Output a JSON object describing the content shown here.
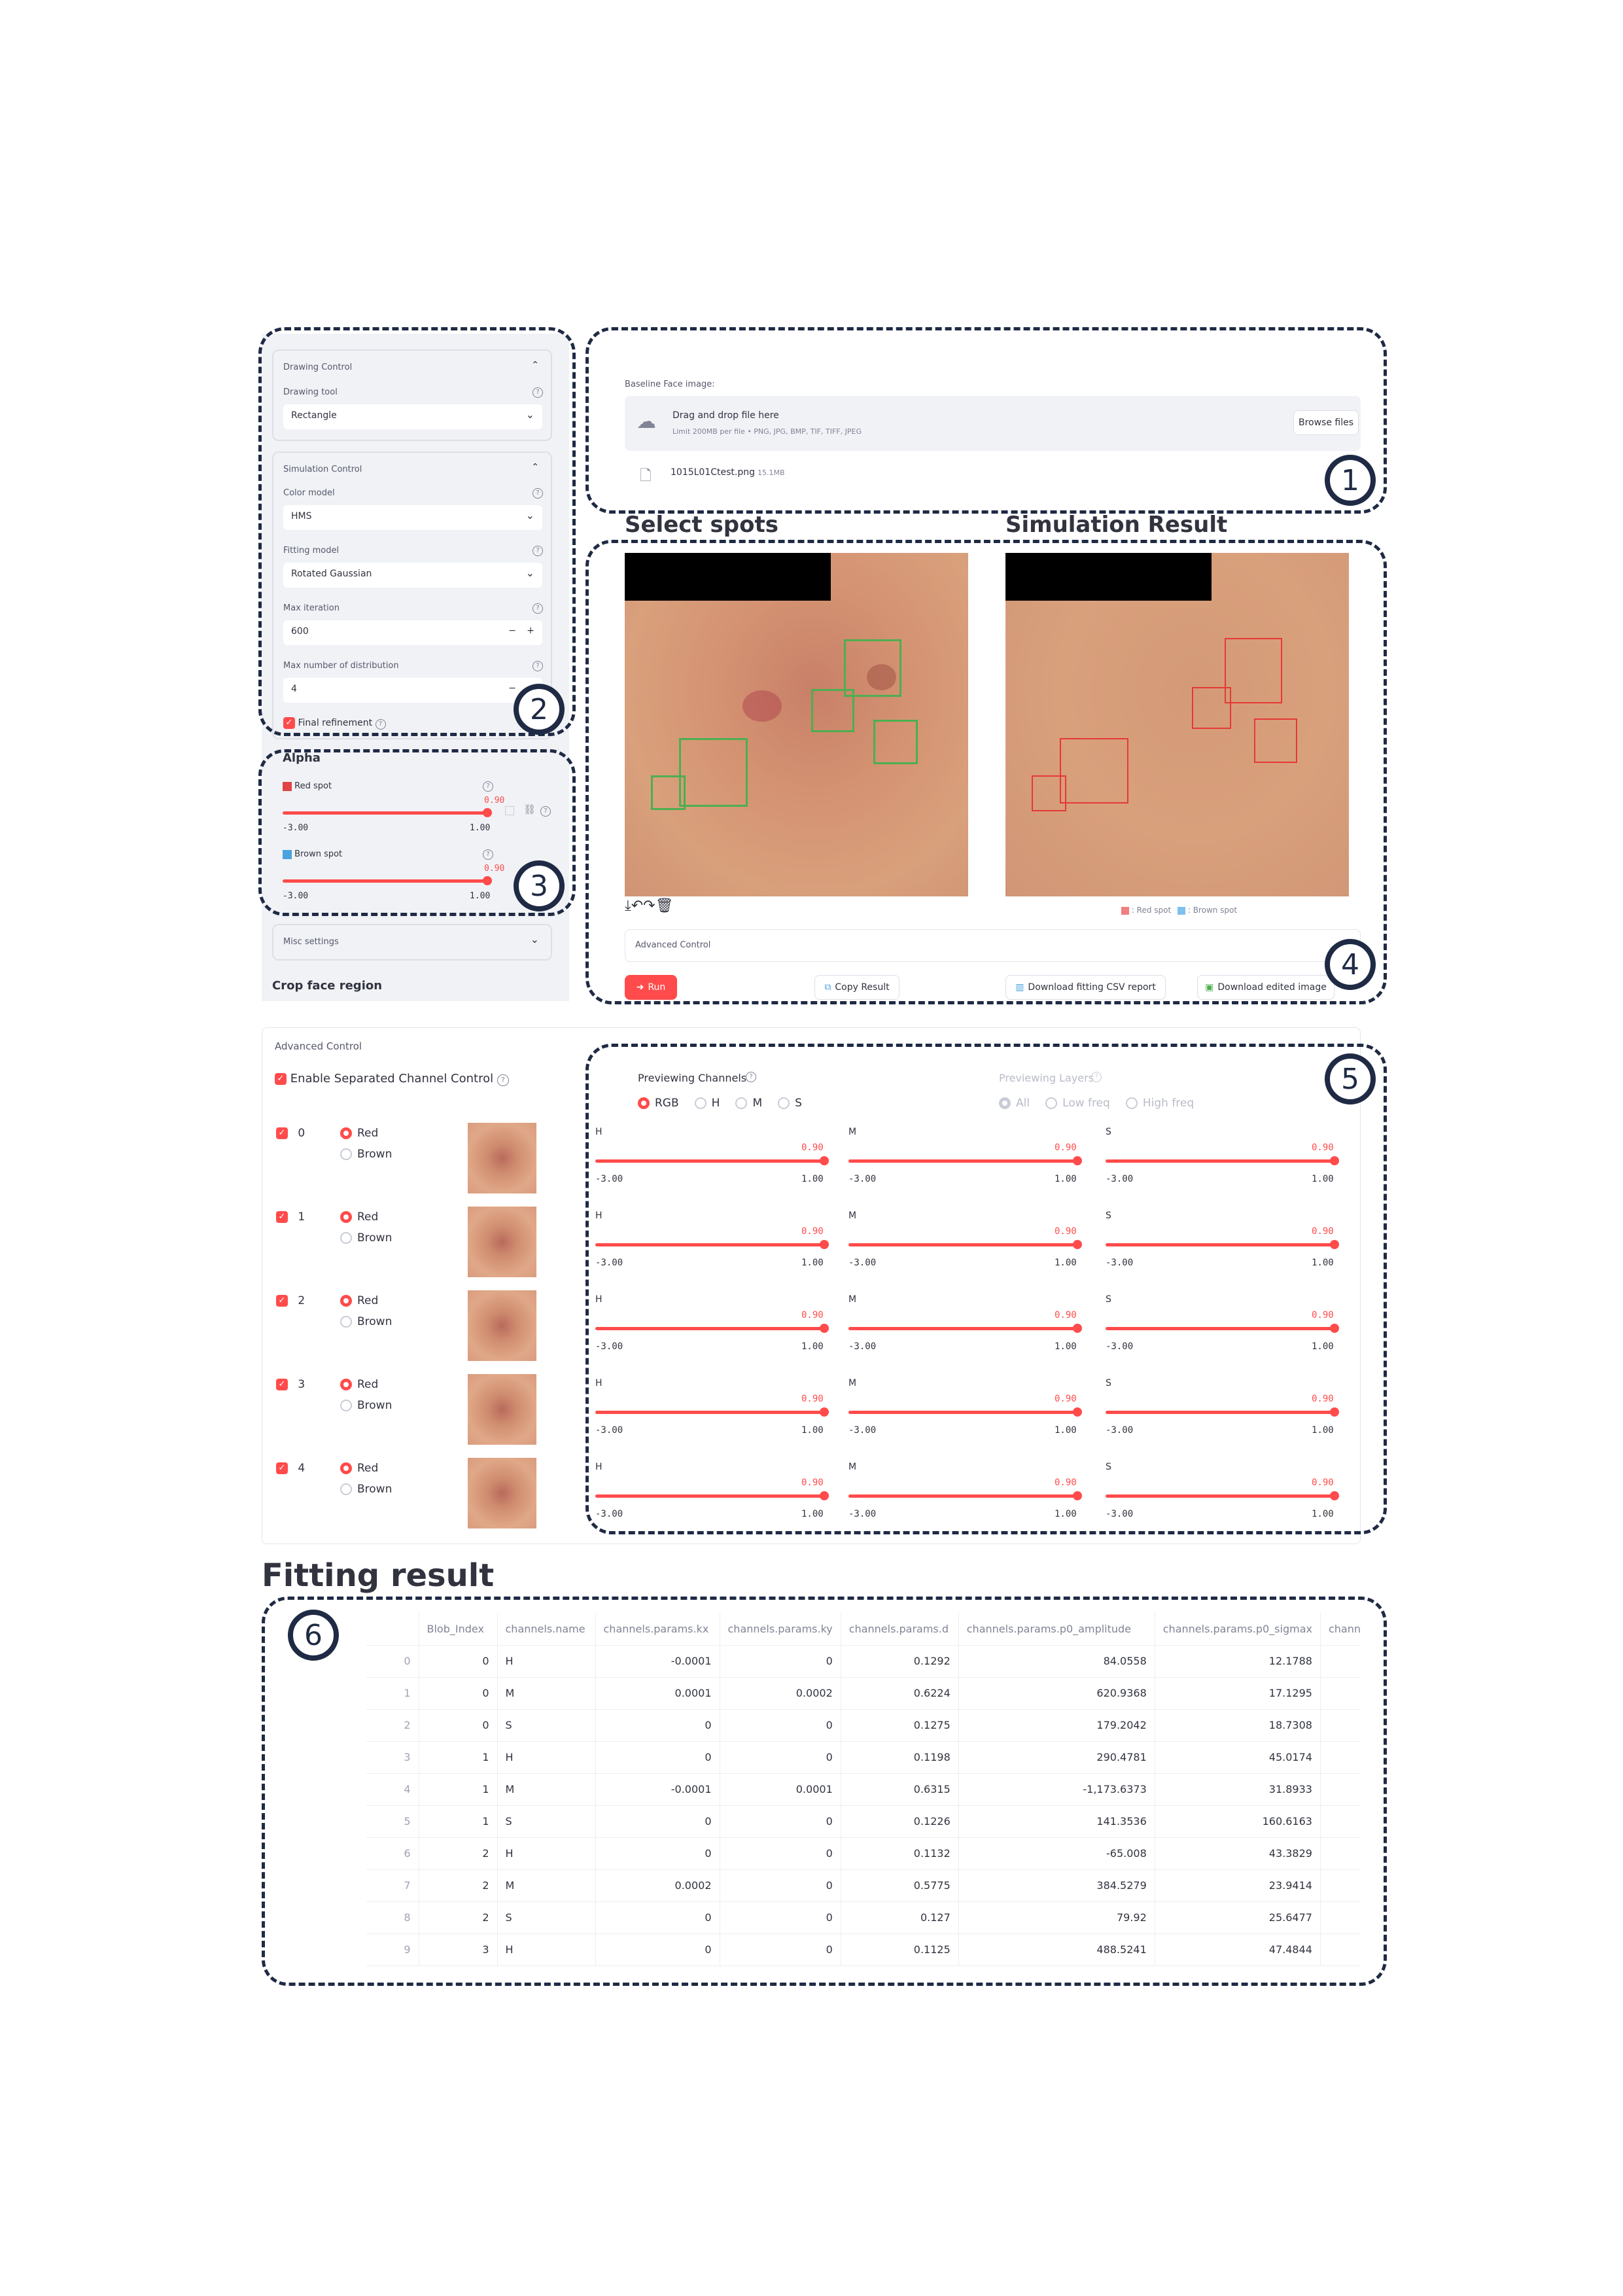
{
  "sidebar": {
    "drawing": {
      "title": "Drawing Control",
      "tool_label": "Drawing tool",
      "tool_value": "Rectangle"
    },
    "simulation": {
      "title": "Simulation Control",
      "color_model_label": "Color model",
      "color_model_value": "HMS",
      "fitting_model_label": "Fitting model",
      "fitting_model_value": "Rotated Gaussian",
      "max_iter_label": "Max iteration",
      "max_iter_value": "600",
      "max_dist_label": "Max number of distribution",
      "max_dist_value": "4",
      "final_refine_label": "Final refinement"
    },
    "alpha": {
      "title": "Alpha",
      "red_label": "Red spot",
      "red_value": "0.90",
      "brown_label": "Brown spot",
      "brown_value": "0.90",
      "min": "-3.00",
      "max": "1.00"
    },
    "misc": "Misc settings",
    "crop": "Crop face region"
  },
  "upload": {
    "label": "Baseline Face image:",
    "drop_text": "Drag and drop file here",
    "limit_text": "Limit 200MB per file • PNG, JPG, BMP, TIF, TIFF, JPEG",
    "browse": "Browse files",
    "file_name": "1015L01Ctest.png",
    "file_size": "15.1MB"
  },
  "headings": {
    "select": "Select spots",
    "result": "Simulation Result",
    "fitting": "Fitting result"
  },
  "legend": {
    "red": "Red spot",
    "brown": "Brown spot"
  },
  "actions": {
    "advanced": "Advanced Control",
    "run": "Run",
    "copy": "Copy Result",
    "csv": "Download fitting CSV report",
    "edited": "Download edited image"
  },
  "advanced": {
    "title": "Advanced Control",
    "enable": "Enable Separated Channel Control",
    "preview_channels": "Previewing Channels",
    "channels": [
      "RGB",
      "H",
      "M",
      "S"
    ],
    "preview_layers": "Previewing Layers",
    "layers": [
      "All",
      "Low freq",
      "High freq"
    ],
    "blobs": [
      {
        "id": "0"
      },
      {
        "id": "1"
      },
      {
        "id": "2"
      },
      {
        "id": "3"
      },
      {
        "id": "4"
      }
    ],
    "red": "Red",
    "brown": "Brown",
    "slider_names": [
      "H",
      "M",
      "S"
    ],
    "value": "0.90",
    "min": "-3.00",
    "max": "1.00"
  },
  "markers": [
    "1",
    "2",
    "3",
    "4",
    "5",
    "6"
  ],
  "table": {
    "columns": [
      "",
      "Blob_Index",
      "channels.name",
      "channels.params.kx",
      "channels.params.ky",
      "channels.params.d",
      "channels.params.p0_amplitude",
      "channels.params.p0_sigmax",
      "channe"
    ],
    "rows": [
      [
        "0",
        "0",
        "H",
        "-0.0001",
        "0",
        "0.1292",
        "84.0558",
        "12.1788"
      ],
      [
        "1",
        "0",
        "M",
        "0.0001",
        "0.0002",
        "0.6224",
        "620.9368",
        "17.1295"
      ],
      [
        "2",
        "0",
        "S",
        "0",
        "0",
        "0.1275",
        "179.2042",
        "18.7308"
      ],
      [
        "3",
        "1",
        "H",
        "0",
        "0",
        "0.1198",
        "290.4781",
        "45.0174"
      ],
      [
        "4",
        "1",
        "M",
        "-0.0001",
        "0.0001",
        "0.6315",
        "-1,173.6373",
        "31.8933"
      ],
      [
        "5",
        "1",
        "S",
        "0",
        "0",
        "0.1226",
        "141.3536",
        "160.6163"
      ],
      [
        "6",
        "2",
        "H",
        "0",
        "0",
        "0.1132",
        "-65.008",
        "43.3829"
      ],
      [
        "7",
        "2",
        "M",
        "0.0002",
        "0",
        "0.5775",
        "384.5279",
        "23.9414"
      ],
      [
        "8",
        "2",
        "S",
        "0",
        "0",
        "0.127",
        "79.92",
        "25.6477"
      ],
      [
        "9",
        "3",
        "H",
        "0",
        "0",
        "0.1125",
        "488.5241",
        "47.4844"
      ]
    ]
  }
}
